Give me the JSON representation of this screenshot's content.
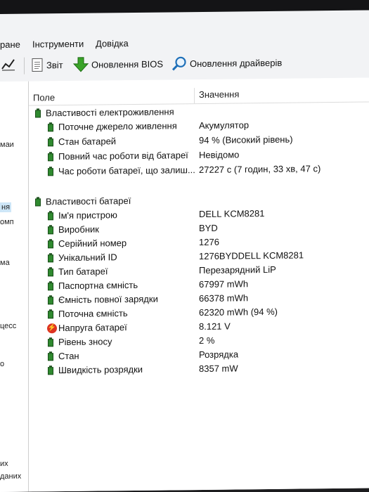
{
  "menu": {
    "left_fragment": "ране",
    "tools": "Інструменти",
    "help": "Довідка"
  },
  "toolbar": {
    "report": "Звіт",
    "bios_update": "Оновлення BIOS",
    "driver_update": "Оновлення драйверів"
  },
  "left_pane": {
    "items": [
      "маи",
      "ня",
      "омп",
      "ма",
      "цесс",
      "о",
      "их",
      "даних"
    ]
  },
  "table": {
    "col_field": "Поле",
    "col_value": "Значення"
  },
  "groups": [
    {
      "title": "Властивості електроживлення",
      "rows": [
        {
          "label": "Поточне джерело живлення",
          "value": "Акумулятор"
        },
        {
          "label": "Стан батарей",
          "value": "94 % (Високий рівень)"
        },
        {
          "label": "Повний час роботи від батареї",
          "value": "Невідомо"
        },
        {
          "label": "Час роботи батареї, що залиш...",
          "value": "27227 с (7 годин, 33 хв, 47 с)"
        }
      ]
    },
    {
      "title": "Властивості батареї",
      "rows": [
        {
          "label": "Ім'я пристрою",
          "value": "DELL KCM8281"
        },
        {
          "label": "Виробник",
          "value": "BYD"
        },
        {
          "label": "Серійний номер",
          "value": "1276"
        },
        {
          "label": "Унікальний ID",
          "value": "1276BYDDELL KCM8281"
        },
        {
          "label": "Тип батареї",
          "value": "Перезарядний LiP"
        },
        {
          "label": "Паспортна ємність",
          "value": "67997 mWh"
        },
        {
          "label": "Ємність повної зарядки",
          "value": "66378 mWh"
        },
        {
          "label": "Поточна ємність",
          "value": "62320 mWh  (94 %)"
        },
        {
          "label": "Напруга батареї",
          "value": "8.121 V"
        },
        {
          "label": "Рівень зносу",
          "value": "2 %"
        },
        {
          "label": "Стан",
          "value": "Розрядка"
        },
        {
          "label": "Швидкість розрядки",
          "value": "8357 mW"
        }
      ]
    }
  ]
}
